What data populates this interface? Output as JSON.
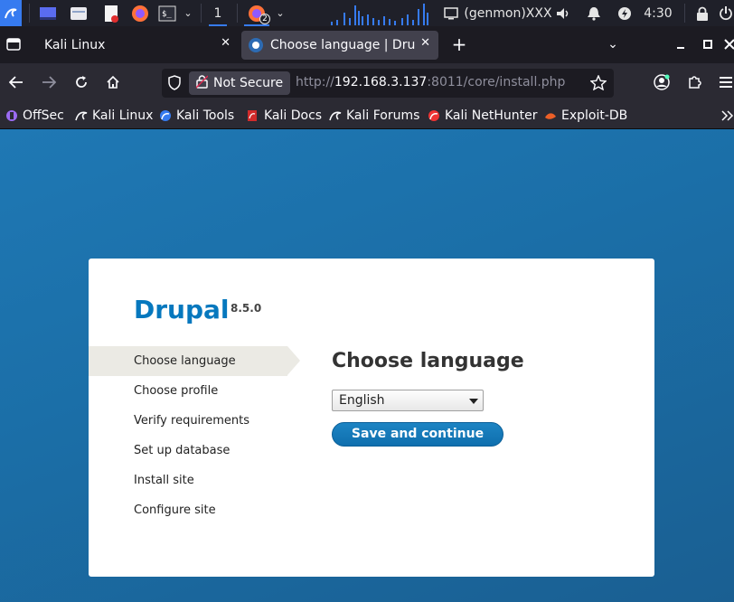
{
  "taskbar": {
    "workspace_number": "1",
    "firefox_badge": "2",
    "genmon_label": "(genmon)XXX",
    "clock": "4:30"
  },
  "tabs": [
    {
      "label": "Kali Linux",
      "active": false
    },
    {
      "label": "Choose language | Drupal",
      "active": true
    }
  ],
  "navbar": {
    "security_label": "Not Secure",
    "url_prefix": "http://",
    "url_host": "192.168.3.137",
    "url_rest": ":8011/core/install.php"
  },
  "bookmarks": [
    {
      "label": "OffSec",
      "icon": "offsec-icon"
    },
    {
      "label": "Kali Linux",
      "icon": "kali-dragon-icon"
    },
    {
      "label": "Kali Tools",
      "icon": "kali-tools-icon"
    },
    {
      "label": "Kali Docs",
      "icon": "kali-docs-icon"
    },
    {
      "label": "Kali Forums",
      "icon": "kali-dragon-icon"
    },
    {
      "label": "Kali NetHunter",
      "icon": "nethunter-icon"
    },
    {
      "label": "Exploit-DB",
      "icon": "exploit-db-icon"
    }
  ],
  "installer": {
    "site_name": "Drupal",
    "version": "8.5.0",
    "steps": [
      "Choose language",
      "Choose profile",
      "Verify requirements",
      "Set up database",
      "Install site",
      "Configure site"
    ],
    "current_step": "Choose language",
    "title": "Choose language",
    "language_selected": "English",
    "submit_label": "Save and continue"
  },
  "colors": {
    "page_background": "#1b6fa8",
    "drupal_blue": "#0678be",
    "accent": "#367bf0"
  }
}
